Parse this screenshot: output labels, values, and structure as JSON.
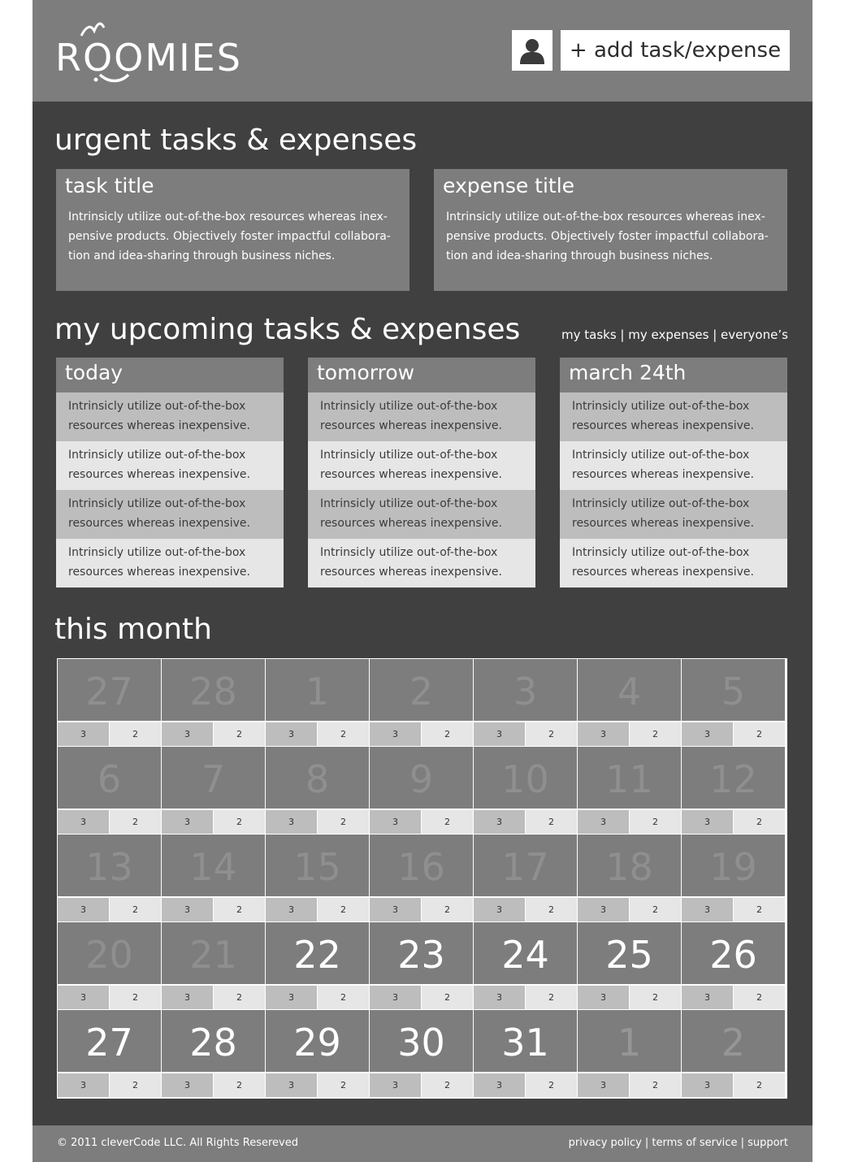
{
  "app": {
    "logo_text": "ROOMIES"
  },
  "header": {
    "add_button_label": "+ add task/expense",
    "profile_icon": "user-icon"
  },
  "urgent": {
    "heading": "urgent tasks & expenses",
    "cards": [
      {
        "title": "task title",
        "body": "Intrinsicly utilize out-of-the-box resources whereas inex-pensive products. Objectively foster impactful collabora-tion and idea-sharing through business niches."
      },
      {
        "title": "expense title",
        "body": "Intrinsicly utilize out-of-the-box resources whereas inex-pensive products. Objectively foster impactful collabora-tion and idea-sharing through business niches."
      }
    ]
  },
  "upcoming": {
    "heading": "my upcoming tasks & expenses",
    "filters": "my tasks | my expenses | everyone’s",
    "columns": [
      {
        "title": "today",
        "items": [
          "Intrinsicly utilize out-of-the-box resources whereas inexpensive.",
          "Intrinsicly utilize out-of-the-box resources whereas inexpensive.",
          "Intrinsicly utilize out-of-the-box resources whereas inexpensive.",
          "Intrinsicly utilize out-of-the-box resources whereas inexpensive."
        ]
      },
      {
        "title": "tomorrow",
        "items": [
          "Intrinsicly utilize out-of-the-box resources whereas inexpensive.",
          "Intrinsicly utilize out-of-the-box resources whereas inexpensive.",
          "Intrinsicly utilize out-of-the-box resources whereas inexpensive.",
          "Intrinsicly utilize out-of-the-box resources whereas inexpensive."
        ]
      },
      {
        "title": "march 24th",
        "items": [
          "Intrinsicly utilize out-of-the-box resources whereas inexpensive.",
          "Intrinsicly utilize out-of-the-box resources whereas inexpensive.",
          "Intrinsicly utilize out-of-the-box resources whereas inexpensive.",
          "Intrinsicly utilize out-of-the-box resources whereas inexpensive."
        ]
      }
    ]
  },
  "month": {
    "heading": "this month",
    "weeks": [
      [
        {
          "day": "27",
          "state": "past"
        },
        {
          "day": "28",
          "state": "past"
        },
        {
          "day": "1",
          "state": "past"
        },
        {
          "day": "2",
          "state": "past"
        },
        {
          "day": "3",
          "state": "past"
        },
        {
          "day": "4",
          "state": "past"
        },
        {
          "day": "5",
          "state": "past"
        }
      ],
      [
        {
          "day": "6",
          "state": "past"
        },
        {
          "day": "7",
          "state": "past"
        },
        {
          "day": "8",
          "state": "past"
        },
        {
          "day": "9",
          "state": "past"
        },
        {
          "day": "10",
          "state": "past"
        },
        {
          "day": "11",
          "state": "past"
        },
        {
          "day": "12",
          "state": "past"
        }
      ],
      [
        {
          "day": "13",
          "state": "past"
        },
        {
          "day": "14",
          "state": "past"
        },
        {
          "day": "15",
          "state": "past"
        },
        {
          "day": "16",
          "state": "past"
        },
        {
          "day": "17",
          "state": "past"
        },
        {
          "day": "18",
          "state": "past"
        },
        {
          "day": "19",
          "state": "past"
        }
      ],
      [
        {
          "day": "20",
          "state": "past"
        },
        {
          "day": "21",
          "state": "past"
        },
        {
          "day": "22",
          "state": "current"
        },
        {
          "day": "23",
          "state": "current"
        },
        {
          "day": "24",
          "state": "current"
        },
        {
          "day": "25",
          "state": "current"
        },
        {
          "day": "26",
          "state": "current"
        }
      ],
      [
        {
          "day": "27",
          "state": "current"
        },
        {
          "day": "28",
          "state": "current"
        },
        {
          "day": "29",
          "state": "current"
        },
        {
          "day": "30",
          "state": "current"
        },
        {
          "day": "31",
          "state": "current"
        },
        {
          "day": "1",
          "state": "other"
        },
        {
          "day": "2",
          "state": "other"
        }
      ]
    ],
    "task_count": "3",
    "expense_count": "2"
  },
  "footer": {
    "copyright": "© 2011 cleverCode LLC. All Rights Resereved",
    "links": "privacy policy | terms of service | support"
  },
  "colors": {
    "page_bg": "#404040",
    "panel": "#7d7d7d",
    "row_dark": "#bdbdbd",
    "row_light": "#e6e6e6",
    "text": "#ffffff"
  }
}
